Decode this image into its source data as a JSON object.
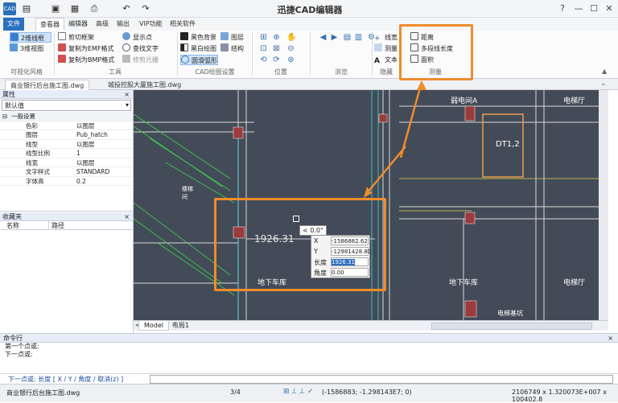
{
  "titlebar": {
    "app_icon_text": "CAD",
    "title": "迅捷CAD编辑器",
    "quick_icons": [
      "open-folder-icon",
      "save-icon",
      "print-icon",
      "undo-icon",
      "redo-icon"
    ],
    "window_controls": [
      "?",
      "—",
      "☐",
      "✕"
    ]
  },
  "menu": {
    "file": "文件",
    "tabs": [
      "查看器",
      "编辑器",
      "高级",
      "输出",
      "VIP功能",
      "相关软件"
    ]
  },
  "ribbon": {
    "visual_style": {
      "btn_2d": "2维线框",
      "btn_3d": "3维视图",
      "label": "可视化风格"
    },
    "tools": {
      "items": [
        "剪切框架",
        "复制为EMF格式",
        "复制为BMP格式",
        "显示点",
        "查找文字",
        "修剪光栅"
      ],
      "label": "工具"
    },
    "cad_settings": {
      "items": [
        "黑色背景",
        "黑白绘图",
        "圆滑弧形",
        "图层",
        "结构"
      ],
      "label": "CAD绘图设置"
    },
    "position": {
      "label": "位置"
    },
    "browse": {
      "label": "浏览"
    },
    "hide": {
      "items": [
        "线宽",
        "测量",
        "文本"
      ],
      "label": "隐藏"
    },
    "measure": {
      "items": [
        "距离",
        "多段线长度",
        "面积"
      ],
      "label": "测量"
    }
  },
  "doc_tabs": [
    "商业银行后台施工图.dwg",
    "城投控股大厦施工图.dwg"
  ],
  "properties": {
    "header": "属性",
    "dropdown_value": "默认值",
    "section": "一般设置",
    "rows": [
      {
        "key": "色彩",
        "value": "以图层"
      },
      {
        "key": "图层",
        "value": "Pub_hatch"
      },
      {
        "key": "线型",
        "value": "以图层"
      },
      {
        "key": "线型比例",
        "value": "1"
      },
      {
        "key": "线宽",
        "value": "以图层"
      },
      {
        "key": "文字样式",
        "value": "STANDARD"
      },
      {
        "key": "字体高",
        "value": "0.2"
      }
    ]
  },
  "favorites": {
    "header": "收藏夹",
    "col_name": "名称",
    "col_path": "路径"
  },
  "drawing": {
    "labels": {
      "zone_a": "弱电间A",
      "elevator_room_top": "电梯厅",
      "dt": "DT1,2",
      "garage_left": "地下车库",
      "garage_right": "地下车库",
      "elevator_room_right": "电梯厅",
      "elevator_machine": "电梯基坑",
      "stair_note": "楼梯间"
    },
    "dimension_text": "1926.31",
    "angle_tip": "< 0.0°",
    "input": {
      "x_label": "X",
      "x_value": "-1586882.62",
      "y_label": "Y",
      "y_value": "-12981428.80",
      "len_label": "长度",
      "len_value": "1926.31",
      "angle_label": "角度",
      "angle_value": "0.00"
    }
  },
  "layout_tabs": [
    "Model",
    "布局1"
  ],
  "command": {
    "header": "命令行",
    "history": [
      "第一个点或:",
      "下一点或:"
    ],
    "prompt": "下一点或: 长度 [ X / Y / 角度 / 取消(z) ]"
  },
  "status": {
    "file": "商业银行后台施工图.dwg",
    "page": "3/4",
    "coords": "(-1586883; -1.298143E7; 0)",
    "size": "2106749 x 1.320073E+007 x 100402.8"
  },
  "colors": {
    "accent": "#2b6fbf",
    "highlight": "#f08c2c",
    "canvas_bg": "#434b58"
  }
}
